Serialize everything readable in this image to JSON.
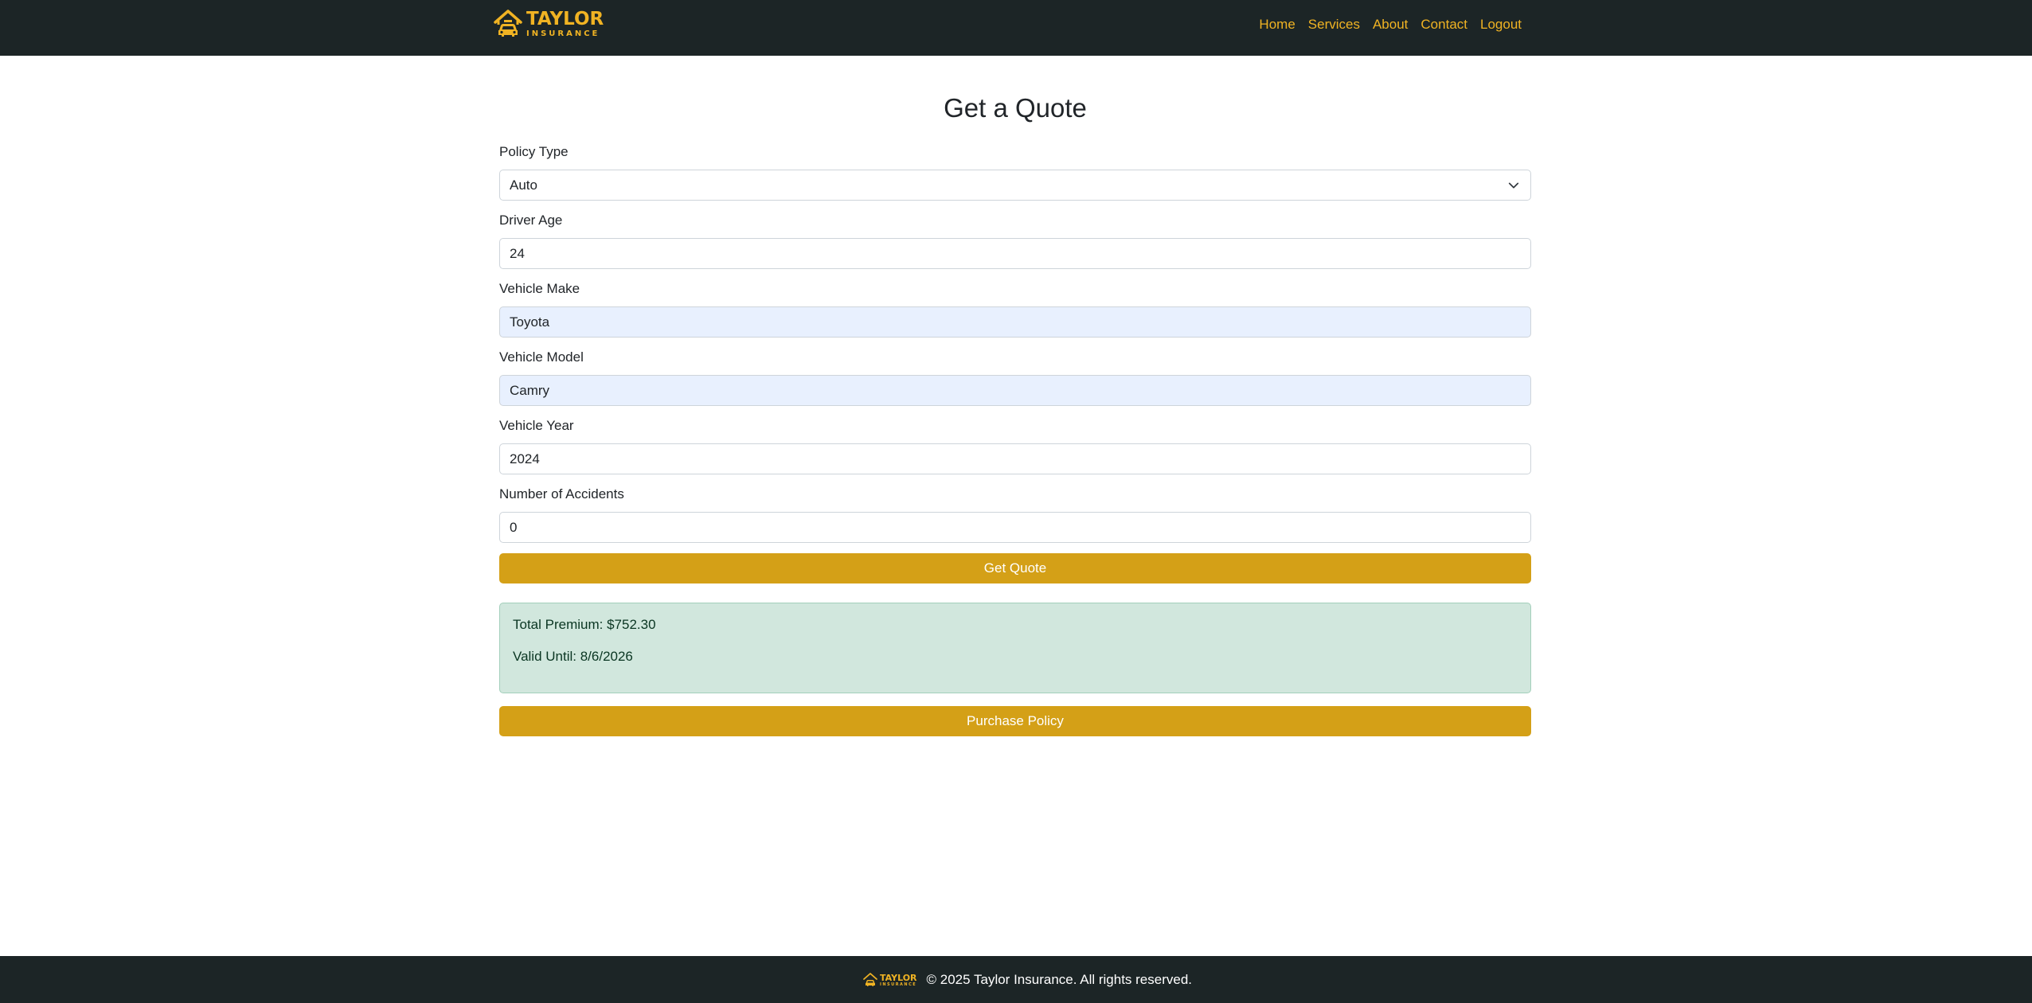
{
  "brand": {
    "name": "TAYLOR",
    "sub": "INSURANCE",
    "accent": "#f0b323"
  },
  "nav": {
    "items": [
      {
        "label": "Home"
      },
      {
        "label": "Services"
      },
      {
        "label": "About"
      },
      {
        "label": "Contact"
      },
      {
        "label": "Logout"
      }
    ]
  },
  "page": {
    "title": "Get a Quote"
  },
  "form": {
    "policy_type": {
      "label": "Policy Type",
      "value": "Auto"
    },
    "driver_age": {
      "label": "Driver Age",
      "value": "24"
    },
    "vehicle_make": {
      "label": "Vehicle Make",
      "value": "Toyota"
    },
    "vehicle_model": {
      "label": "Vehicle Model",
      "value": "Camry"
    },
    "vehicle_year": {
      "label": "Vehicle Year",
      "value": "2024"
    },
    "accidents": {
      "label": "Number of Accidents",
      "value": "0"
    },
    "submit_label": "Get Quote"
  },
  "result": {
    "premium": "Total Premium: $752.30",
    "valid_until": "Valid Until: 8/6/2026",
    "purchase_label": "Purchase Policy"
  },
  "footer": {
    "text": "© 2025 Taylor Insurance. All rights reserved."
  },
  "colors": {
    "navbar_bg": "#1c2526",
    "button_gold": "#d4a017",
    "alert_bg": "#d1e7dd",
    "autofill_bg": "#e8f0fe"
  }
}
